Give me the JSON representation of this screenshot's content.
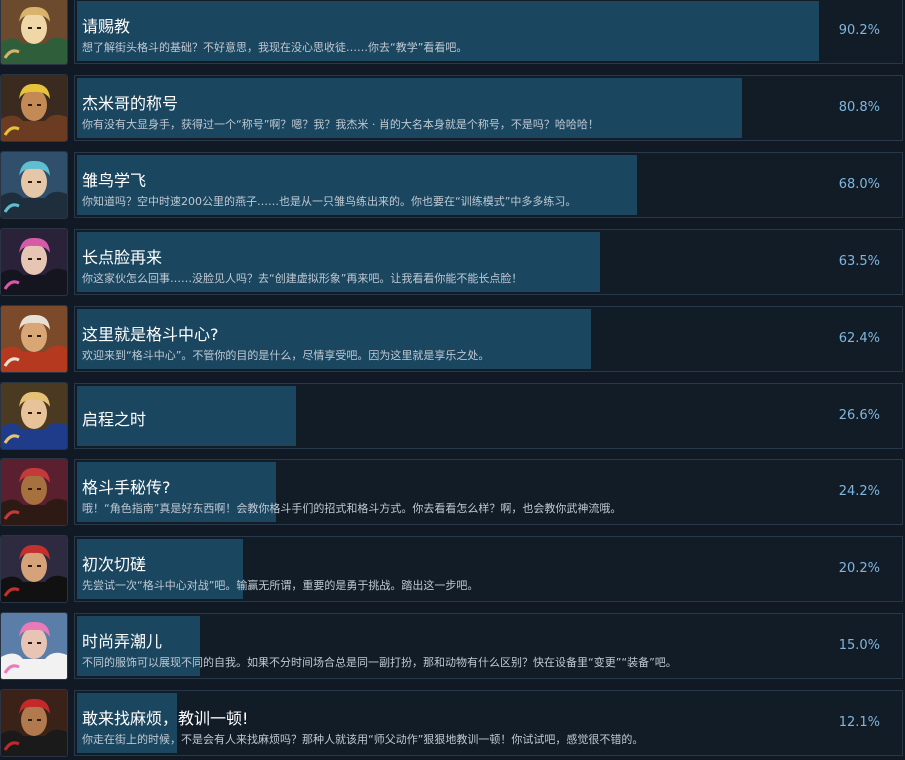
{
  "achievements": [
    {
      "title": "请赐教",
      "description": "想了解街头格斗的基础？不好意思，我现在没心思收徒……你去“教学”看看吧。",
      "percent": "90.2%",
      "progress": 0.902,
      "icon": "fighter-portrait-blonde-jacket-icon",
      "colors": [
        "#6b4a2e",
        "#d9b36b",
        "#2e5e3a",
        "#f0d7a8"
      ]
    },
    {
      "title": "杰米哥的称号",
      "description": "你有没有大显身手，获得过一个“称号”啊？嗯？我？我杰米 · 肖的大名本身就是个称号，不是吗？哈哈哈！",
      "percent": "80.8%",
      "progress": 0.808,
      "icon": "fighter-portrait-jamie-yellow-icon",
      "colors": [
        "#3a2a20",
        "#e6c33a",
        "#6b3b22",
        "#c48a55"
      ]
    },
    {
      "title": "雏鸟学飞",
      "description": "你知道吗？空中时速200公里的燕子……也是从一只雏鸟练出来的。你也要在“训练模式”中多多练习。",
      "percent": "68.0%",
      "progress": 0.68,
      "icon": "fighter-portrait-chunli-icon",
      "colors": [
        "#2f4f6a",
        "#5fbfd0",
        "#1f2e3c",
        "#e5c7a8"
      ]
    },
    {
      "title": "长点脸再来",
      "description": "你这家伙怎么回事……没脸见人吗？去“创建虚拟形象”再来吧。让我看看你能不能长点脸！",
      "percent": "63.5%",
      "progress": 0.635,
      "icon": "fighter-portrait-juri-icon",
      "colors": [
        "#2a2238",
        "#d65aa8",
        "#151520",
        "#e6c5b5"
      ]
    },
    {
      "title": "这里就是格斗中心?",
      "description": "欢迎来到“格斗中心”。不管你的目的是什么，尽情享受吧。因为这里就是享乐之处。",
      "percent": "62.4%",
      "progress": 0.624,
      "icon": "fighter-portrait-elder-icon",
      "colors": [
        "#7a4a2a",
        "#e8e0d4",
        "#b5391f",
        "#d9a676"
      ]
    },
    {
      "title": "启程之时",
      "description": "",
      "percent": "26.6%",
      "progress": 0.266,
      "icon": "fighter-portrait-luke-icon",
      "colors": [
        "#4a3a22",
        "#e6c277",
        "#1f3c8a",
        "#e8c39a"
      ]
    },
    {
      "title": "格斗手秘传?",
      "description": "哦！“角色指南”真是好东西啊！会教你格斗手们的招式和格斗方式。你去看看怎么样？啊，也会教你武神流哦。",
      "percent": "24.2%",
      "progress": 0.242,
      "icon": "fighter-portrait-kimberly-icon",
      "colors": [
        "#5a2030",
        "#c43a3a",
        "#2e1a14",
        "#a6703f"
      ]
    },
    {
      "title": "初次切磋",
      "description": "先尝试一次“格斗中心对战”吧。输赢无所谓，重要的是勇于挑战。踏出这一步吧。",
      "percent": "20.2%",
      "progress": 0.202,
      "icon": "fighter-portrait-ryu-icon",
      "colors": [
        "#2e2a40",
        "#c43030",
        "#111111",
        "#d6a27a"
      ]
    },
    {
      "title": "时尚弄潮儿",
      "description": "不同的服饰可以展现不同的自我。如果不分时间场合总是同一副打扮，那和动物有什么区别？快在设备里“变更”“装备”吧。",
      "percent": "15.0%",
      "progress": 0.15,
      "icon": "fighter-portrait-manon-icon",
      "colors": [
        "#5a7ea8",
        "#e87ab8",
        "#f2f2f2",
        "#e8c4b4"
      ]
    },
    {
      "title": "敢来找麻烦，教训一顿!",
      "description": "你走在街上的时候，不是会有人来找麻烦吗？那种人就该用“师父动作”狠狠地教训一顿！你试试吧，感觉很不错的。",
      "percent": "12.1%",
      "progress": 0.121,
      "icon": "fighter-portrait-masked-icon",
      "colors": [
        "#3a2218",
        "#c4282a",
        "#1a1a1a",
        "#b07a4e"
      ]
    }
  ]
}
